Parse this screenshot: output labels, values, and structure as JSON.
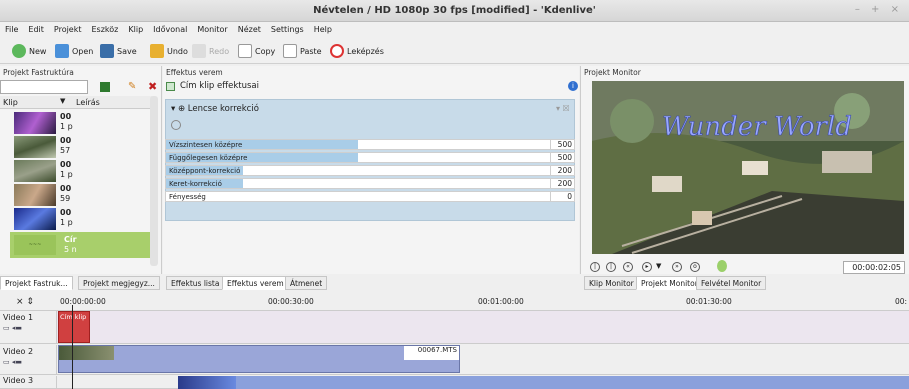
{
  "window": {
    "title": "Névtelen / HD 1080p 30 fps [modified] - 'Kdenlive'",
    "controls": "– + ×"
  },
  "menu": [
    "File",
    "Edit",
    "Projekt",
    "Eszköz",
    "Klip",
    "Idővonal",
    "Monitor",
    "Nézet",
    "Settings",
    "Help"
  ],
  "toolbar": {
    "new": "New",
    "open": "Open",
    "save": "Save",
    "undo": "Undo",
    "redo": "Redo",
    "copy": "Copy",
    "paste": "Paste",
    "render": "Leképzés"
  },
  "project_tree": {
    "title": "Projekt Fastruktúra",
    "col_clip": "Klip",
    "col_desc": "Leírás",
    "clips": [
      {
        "name": "00",
        "sub": "1 p"
      },
      {
        "name": "00",
        "sub": "57"
      },
      {
        "name": "00",
        "sub": "1 p"
      },
      {
        "name": "00",
        "sub": "59"
      },
      {
        "name": "00",
        "sub": "1 p"
      },
      {
        "name": "Cír",
        "sub": "5 n"
      }
    ],
    "tabs": [
      "Projekt Fastruk...",
      "Projekt megjegyz..."
    ]
  },
  "effects": {
    "title": "Effektus verem",
    "clip_title": "Cím klip effektusai",
    "effect_name": "Lencse korrekció",
    "params": [
      {
        "label": "Vízszintesen középre",
        "value": "500",
        "fill": 0.5
      },
      {
        "label": "Függőlegesen középre",
        "value": "500",
        "fill": 0.5
      },
      {
        "label": "Középpont-korrekció",
        "value": "200",
        "fill": 0.2
      },
      {
        "label": "Keret-korrekció",
        "value": "200",
        "fill": 0.2
      },
      {
        "label": "Fényesség",
        "value": "0",
        "fill": 0
      }
    ],
    "tabs": [
      "Effektus lista",
      "Effektus verem",
      "Átmenet"
    ]
  },
  "monitor": {
    "title": "Projekt Monitor",
    "overlay_text": "Wunder World",
    "timecode": "00:00:02:05",
    "tabs": [
      "Klip Monitor",
      "Projekt Monitor",
      "Felvétel Monitor"
    ]
  },
  "timeline": {
    "ruler": [
      "00:00:00:00",
      "00:00:30:00",
      "00:01:00:00",
      "00:01:30:00",
      "00:"
    ],
    "tracks": [
      {
        "name": "Video 1",
        "clip": "Cím klip"
      },
      {
        "name": "Video 2",
        "clip": "00067.MTS"
      },
      {
        "name": "Video 3",
        "clip": ""
      }
    ]
  },
  "colors": {
    "accent": "#3b7ec8",
    "selected": "#a8cf6b",
    "title_clip": "#d04040"
  }
}
